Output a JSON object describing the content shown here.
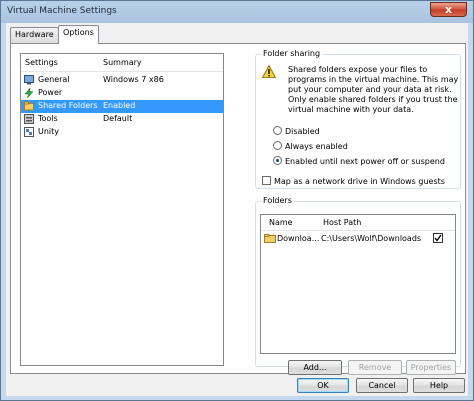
{
  "window": {
    "title": "Virtual Machine Settings",
    "close_glyph": "x"
  },
  "tabs": [
    {
      "label": "Hardware"
    },
    {
      "label": "Options"
    }
  ],
  "settings_list": {
    "col_settings": "Settings",
    "col_summary": "Summary",
    "items": [
      {
        "name": "General",
        "summary": "Windows 7 x86"
      },
      {
        "name": "Power",
        "summary": ""
      },
      {
        "name": "Shared Folders",
        "summary": "Enabled"
      },
      {
        "name": "Tools",
        "summary": "Default"
      },
      {
        "name": "Unity",
        "summary": ""
      }
    ]
  },
  "folder_sharing": {
    "title": "Folder sharing",
    "warning": "Shared folders expose your files to programs in the virtual machine. This may put your computer and your data at risk. Only enable shared folders if you trust the virtual machine with your data.",
    "options": [
      {
        "label": "Disabled",
        "selected": false
      },
      {
        "label": "Always enabled",
        "selected": false
      },
      {
        "label": "Enabled until next power off or suspend",
        "selected": true
      }
    ],
    "map_drive_label": "Map as a network drive in Windows guests",
    "map_drive_checked": false
  },
  "folders": {
    "title": "Folders",
    "col_name": "Name",
    "col_host_path": "Host Path",
    "rows": [
      {
        "name": "Downloa...",
        "path": "C:\\Users\\Wolf\\Downloads",
        "enabled": true
      }
    ],
    "add_label": "Add...",
    "remove_label": "Remove",
    "properties_label": "Properties"
  },
  "footer": {
    "ok_label": "OK",
    "cancel_label": "Cancel",
    "help_label": "Help"
  },
  "colors": {
    "selection": "#3399ff",
    "titlebar": "#b9d1ea",
    "close": "#c13b22"
  }
}
